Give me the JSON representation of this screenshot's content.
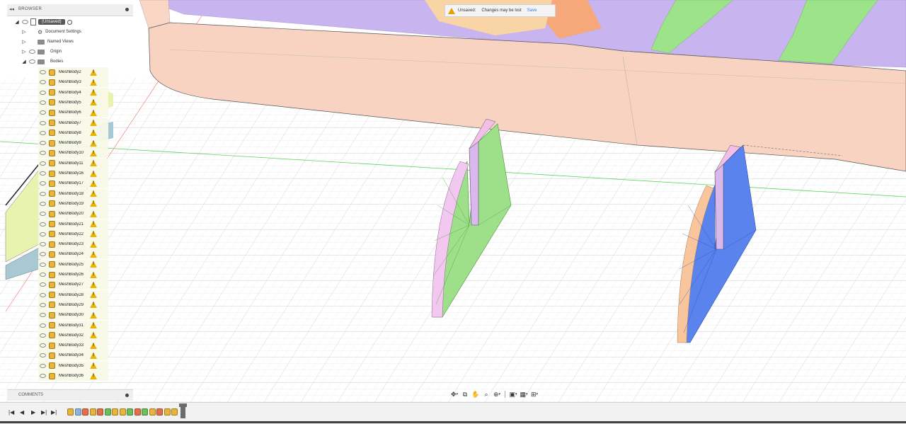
{
  "browser": {
    "title": "BROWSER",
    "root_label": "(Unsaved)",
    "items": [
      {
        "label": "Document Settings"
      },
      {
        "label": "Named Views"
      },
      {
        "label": "Origin"
      },
      {
        "label": "Bodies"
      }
    ],
    "bodies": [
      "MeshBody2",
      "MeshBody3",
      "MeshBody4",
      "MeshBody5",
      "MeshBody6",
      "MeshBody7",
      "MeshBody8",
      "MeshBody9",
      "MeshBody10",
      "MeshBody11",
      "MeshBody16",
      "MeshBody17",
      "MeshBody18",
      "MeshBody19",
      "MeshBody20",
      "MeshBody21",
      "MeshBody22",
      "MeshBody23",
      "MeshBody24",
      "MeshBody25",
      "MeshBody26",
      "MeshBody27",
      "MeshBody28",
      "MeshBody29",
      "MeshBody30",
      "MeshBody31",
      "MeshBody32",
      "MeshBody33",
      "MeshBody34",
      "MeshBody35",
      "MeshBody36"
    ]
  },
  "banner": {
    "status": "Unsaved:",
    "message": "Changes may be lost",
    "action": "Save"
  },
  "comments": {
    "title": "COMMENTS"
  },
  "icons": {
    "collapse": "double-chevron-left-icon",
    "visibility": "eye-icon",
    "mesh": "mesh-body-icon",
    "warning": "warning-triangle-icon",
    "folder": "folder-icon",
    "settings": "gear-icon"
  },
  "colors": {
    "hull": "#f9d3c2",
    "hull_deck": "#c9b5ee",
    "fin_green": "#9be38a",
    "fin_blue": "#5b84ef",
    "fin_pink": "#efc6ee",
    "fin_orange": "#f8c79e",
    "warning": "#e8b400",
    "save_link": "#2a7de1"
  }
}
